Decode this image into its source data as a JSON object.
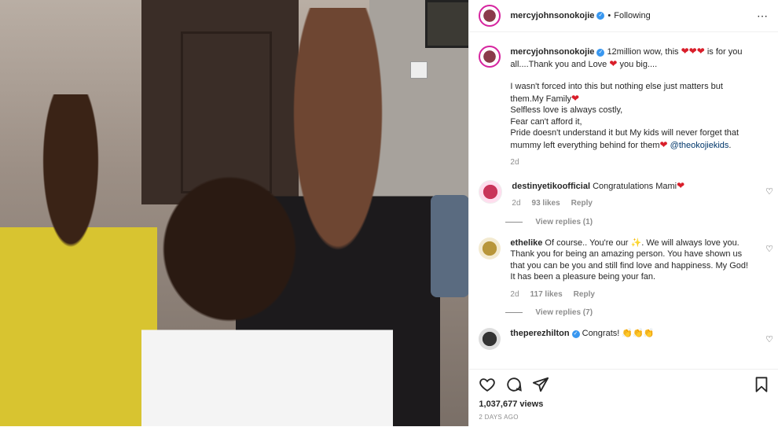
{
  "post": {
    "username": "mercyjohnsonokojie",
    "verified_mark": "✓",
    "separator": "•",
    "follow_status": "Following",
    "more_icon": "⋯",
    "caption_line1": "12million wow, this ",
    "caption_hearts": "❤❤❤",
    "caption_line1b": " is for you all....Thank you and Love ",
    "caption_heart2": "❤",
    "caption_line1c": " you big....",
    "caption_line2": "I wasn't forced into this but nothing else just matters but them.My Family",
    "caption_heart3": "❤",
    "caption_line3": "Selfless love is always costly,",
    "caption_line4": "Fear can't afford it,",
    "caption_line5": "Pride doesn't understand it but My kids will never forget that mummy left everything behind for them",
    "caption_heart4": "❤",
    "caption_tag": "@theokojiekids",
    "caption_end": ".",
    "caption_age": "2d"
  },
  "comments": [
    {
      "username": "destinyetikoofficial",
      "text": "Congratulations Mami",
      "emoji": "❤",
      "age": "2d",
      "likes": "93 likes",
      "reply": "Reply",
      "view_replies": "View replies (1)",
      "avatar_color": "#c9345a"
    },
    {
      "username": "ethelike",
      "text": "Of course.. You're our ",
      "emoji": "✨",
      "text2": ". We will always love you. Thank you for being an amazing person. You have shown us that you can be you and still find love and happiness. My God! It has been a pleasure being your fan.",
      "age": "2d",
      "likes": "117 likes",
      "reply": "Reply",
      "view_replies": "View replies (7)",
      "avatar_color": "#b8963a"
    },
    {
      "username": "theperezhilton",
      "verified_mark": "✓",
      "text": "Congrats! ",
      "emoji": "👏👏👏",
      "avatar_color": "#333333"
    }
  ],
  "footer": {
    "views": "1,037,677 views",
    "time_ago": "2 DAYS AGO",
    "icons": [
      "heart-icon",
      "comment-icon",
      "share-icon",
      "bookmark-icon"
    ]
  },
  "colors": {
    "heart": "#d91e2a",
    "verified": "#3897f0",
    "link": "#00376b",
    "muted": "#8e8e8e"
  }
}
